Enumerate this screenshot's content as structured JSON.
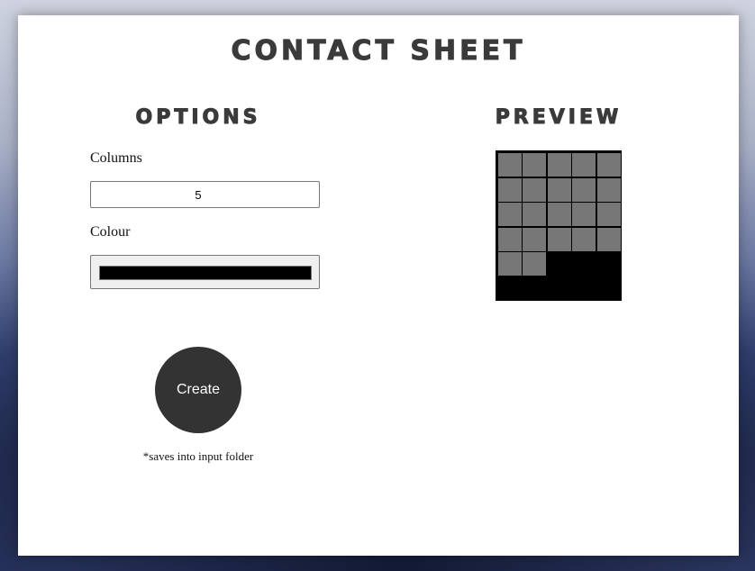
{
  "app": {
    "title": "Contact Sheet"
  },
  "options": {
    "heading": "Options",
    "columns_label": "Columns",
    "columns_value": "5",
    "colour_label": "Colour",
    "colour_value": "#000000",
    "create_label": "Create",
    "note": "*saves into input folder"
  },
  "preview": {
    "heading": "Preview",
    "columns": 5,
    "cell_count": 22,
    "cell_color": "#777777",
    "background_color": "#000000"
  }
}
